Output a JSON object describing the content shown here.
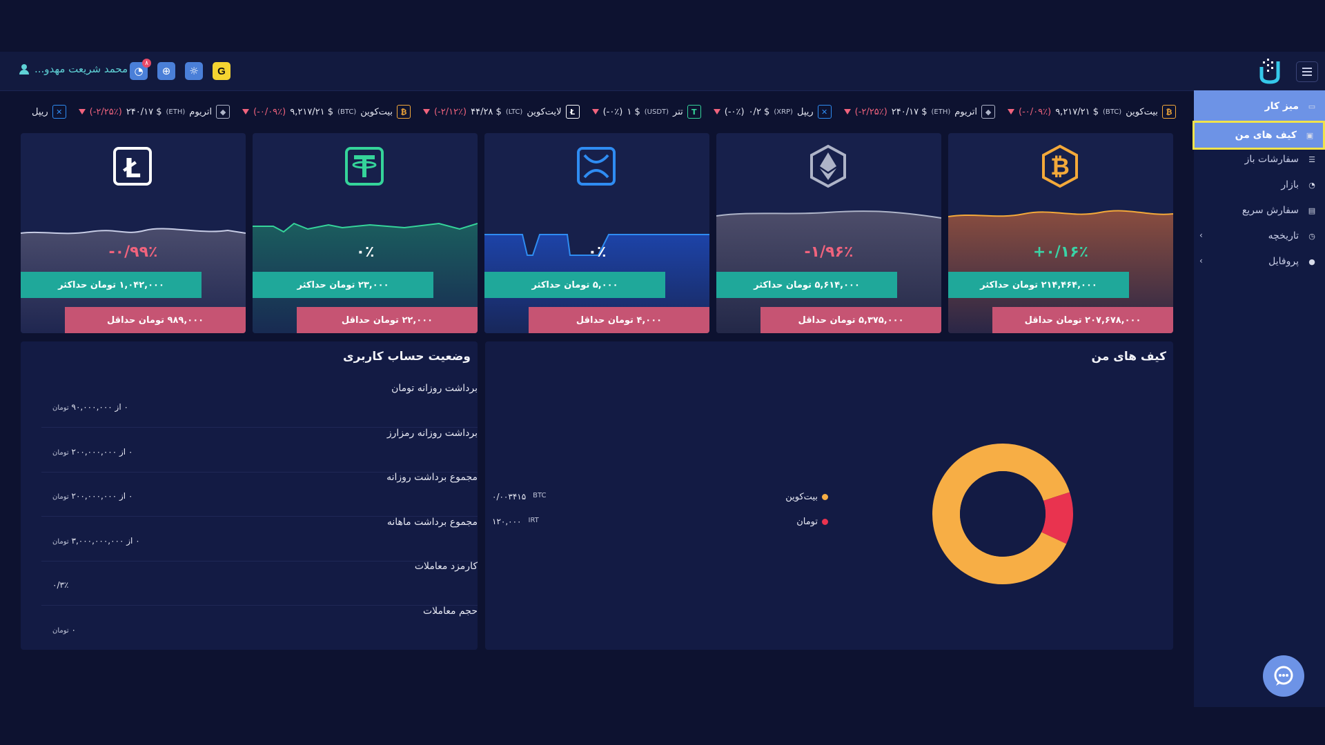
{
  "header": {
    "user_name": "محمد شریعت مهدو...",
    "notification_count": "۸",
    "g_label": "G"
  },
  "ticker": [
    {
      "name": "بیت‌کوین",
      "symbol": "(BTC)",
      "price": "۹,۲۱۷/۲۱ $",
      "change": "(-۰/۰۹٪)",
      "icon": "bitcoin-icon",
      "glyph": "₿",
      "color": "#f4a93a"
    },
    {
      "name": "اتریوم",
      "symbol": "(ETH)",
      "price": "۲۴۰/۱۷ $",
      "change": "(-۲/۲۵٪)",
      "icon": "ethereum-icon",
      "glyph": "◆",
      "color": "#aeb4c8"
    },
    {
      "name": "ریپل",
      "symbol": "(XRP)",
      "price": "۰/۲ $",
      "change": "(-۰٪)",
      "icon": "ripple-icon",
      "glyph": "✕",
      "color": "#2f8cf2"
    },
    {
      "name": "تتر",
      "symbol": "(USDT)",
      "price": "۱ $",
      "change": "(-۰٪)",
      "icon": "tether-icon",
      "glyph": "T",
      "color": "#35d49a"
    },
    {
      "name": "لایت‌کوین",
      "symbol": "(LTC)",
      "price": "۴۴/۲۸ $",
      "change": "(-۲/۱۲٪)",
      "icon": "litecoin-icon",
      "glyph": "Ł",
      "color": "#ffffff"
    },
    {
      "name": "بیت‌کوین",
      "symbol": "(BTC)",
      "price": "۹,۲۱۷/۲۱ $",
      "change": "(-۰/۰۹٪)",
      "icon": "bitcoin-icon",
      "glyph": "₿",
      "color": "#f4a93a"
    },
    {
      "name": "اتریوم",
      "symbol": "(ETH)",
      "price": "۲۴۰/۱۷ $",
      "change": "(-۲/۲۵٪)",
      "icon": "ethereum-icon",
      "glyph": "◆",
      "color": "#aeb4c8"
    },
    {
      "name": "ریپل",
      "symbol": "",
      "price": "",
      "change": "",
      "icon": "ripple-icon",
      "glyph": "✕",
      "color": "#2f8cf2"
    }
  ],
  "cards": [
    {
      "coin": "bitcoin",
      "icon": "bitcoin-icon",
      "color": "#f4a93a",
      "change": "+۰/۱۶٪",
      "change_color": "#3ad3a6",
      "max": "۲۱۴,۴۶۴,۰۰۰ تومان حداکثر",
      "min": "۲۰۷,۶۷۸,۰۰۰ تومان حداقل"
    },
    {
      "coin": "ethereum",
      "icon": "ethereum-icon",
      "color": "#aeb4c8",
      "change": "-۱/۹۶٪",
      "change_color": "#f0637d",
      "max": "۵,۶۱۴,۰۰۰ تومان حداکثر",
      "min": "۵,۳۷۵,۰۰۰ تومان حداقل"
    },
    {
      "coin": "ripple",
      "icon": "ripple-icon",
      "color": "#2f8cf2",
      "change": "۰٪",
      "change_color": "#ffffff",
      "max": "۵,۰۰۰ تومان حداکثر",
      "min": "۴,۰۰۰ تومان حداقل"
    },
    {
      "coin": "tether",
      "icon": "tether-icon",
      "color": "#35d49a",
      "change": "۰٪",
      "change_color": "#ffffff",
      "max": "۲۳,۰۰۰ تومان حداکثر",
      "min": "۲۲,۰۰۰ تومان حداقل"
    },
    {
      "coin": "litecoin",
      "icon": "litecoin-icon",
      "color": "#ffffff",
      "change": "-۰/۹۹٪",
      "change_color": "#f0637d",
      "max": "۱,۰۴۲,۰۰۰ تومان حداکثر",
      "min": "۹۸۹,۰۰۰ تومان حداقل"
    }
  ],
  "wallets": {
    "title": "کیف های من",
    "items": [
      {
        "name": "بیت‌کوین",
        "color": "#f7ae45",
        "amount": "۰/۰۰۳۴۱۵",
        "unit": "BTC"
      },
      {
        "name": "تومان",
        "color": "#e9334f",
        "amount": "۱۲۰,۰۰۰",
        "unit": "IRT"
      }
    ]
  },
  "chart_data": {
    "type": "pie",
    "categories": [
      "بیت‌کوین",
      "تومان"
    ],
    "values": [
      88,
      12
    ],
    "colors": [
      "#f7ae45",
      "#e9334f"
    ]
  },
  "account": {
    "title": "وضعیت حساب کاربری",
    "rows": [
      {
        "label": "برداشت روزانه تومان",
        "value": "۰ از ۹۰,۰۰۰,۰۰۰",
        "unit": "تومان"
      },
      {
        "label": "برداشت روزانه رمزارز",
        "value": "۰ از ۲۰۰,۰۰۰,۰۰۰",
        "unit": "تومان"
      },
      {
        "label": "مجموع برداشت روزانه",
        "value": "۰ از ۲۰۰,۰۰۰,۰۰۰",
        "unit": "تومان"
      },
      {
        "label": "مجموع برداشت ماهانه",
        "value": "۰ از ۳,۰۰۰,۰۰۰,۰۰۰",
        "unit": "تومان"
      },
      {
        "label": "کارمزد معاملات",
        "value": "۰/۳٪",
        "unit": ""
      },
      {
        "label": "حجم معاملات",
        "value": "۰",
        "unit": "تومان"
      }
    ]
  },
  "sidebar": {
    "items": [
      {
        "label": "میز کار",
        "icon": "monitor-icon",
        "glyph": "▭",
        "state": "active",
        "chevron": false
      },
      {
        "label": "کیف های من",
        "icon": "wallet-icon",
        "glyph": "▣",
        "state": "selected",
        "chevron": false
      },
      {
        "label": "سفارشات باز",
        "icon": "list-icon",
        "glyph": "☰",
        "state": "",
        "chevron": false
      },
      {
        "label": "بازار",
        "icon": "market-icon",
        "glyph": "◔",
        "state": "",
        "chevron": false
      },
      {
        "label": "سفارش سریع",
        "icon": "fast-order-icon",
        "glyph": "▤",
        "state": "",
        "chevron": false
      },
      {
        "label": "تاریخچه",
        "icon": "history-icon",
        "glyph": "◷",
        "state": "",
        "chevron": true
      },
      {
        "label": "پروفایل",
        "icon": "profile-icon",
        "glyph": "●",
        "state": "",
        "chevron": true
      }
    ]
  }
}
